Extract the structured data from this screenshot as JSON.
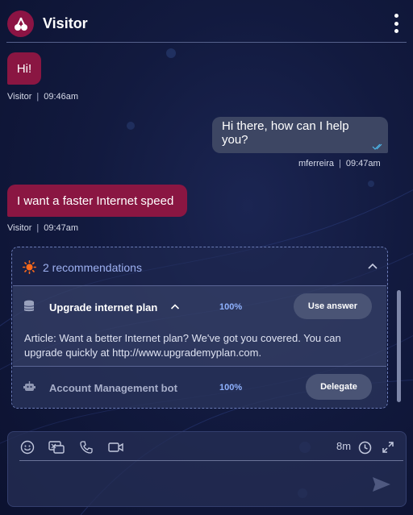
{
  "header": {
    "title": "Visitor",
    "logo_icon": "cherry-logo-icon",
    "menu_icon": "kebab-menu-icon"
  },
  "messages": [
    {
      "text": "Hi!",
      "author": "Visitor",
      "time": "09:46am"
    },
    {
      "text": "Hi there, how can I help you?",
      "author": "mferreira",
      "time": "09:47am"
    },
    {
      "text": "I want a faster Internet speed",
      "author": "Visitor",
      "time": "09:47am"
    }
  ],
  "recommendations": {
    "title": "2 recommendations",
    "items": [
      {
        "name": "Upgrade internet plan",
        "score": "100%",
        "action": "Use answer",
        "icon": "database-icon",
        "expanded": true,
        "detail": "Article: Want a better Internet plan? We've got you covered. You can upgrade quickly at http://www.upgrademyplan.com."
      },
      {
        "name": "Account Management bot",
        "score": "100%",
        "action": "Delegate",
        "icon": "bot-icon",
        "expanded": false
      }
    ]
  },
  "composer": {
    "timer": "8m",
    "tools": [
      "emoji-icon",
      "screen-share-icon",
      "phone-icon",
      "video-icon"
    ]
  },
  "colors": {
    "visitor_bubble": "#8a1642",
    "agent_bubble": "#3d4663",
    "accent": "#9db0f0",
    "background": "#121a3f"
  }
}
